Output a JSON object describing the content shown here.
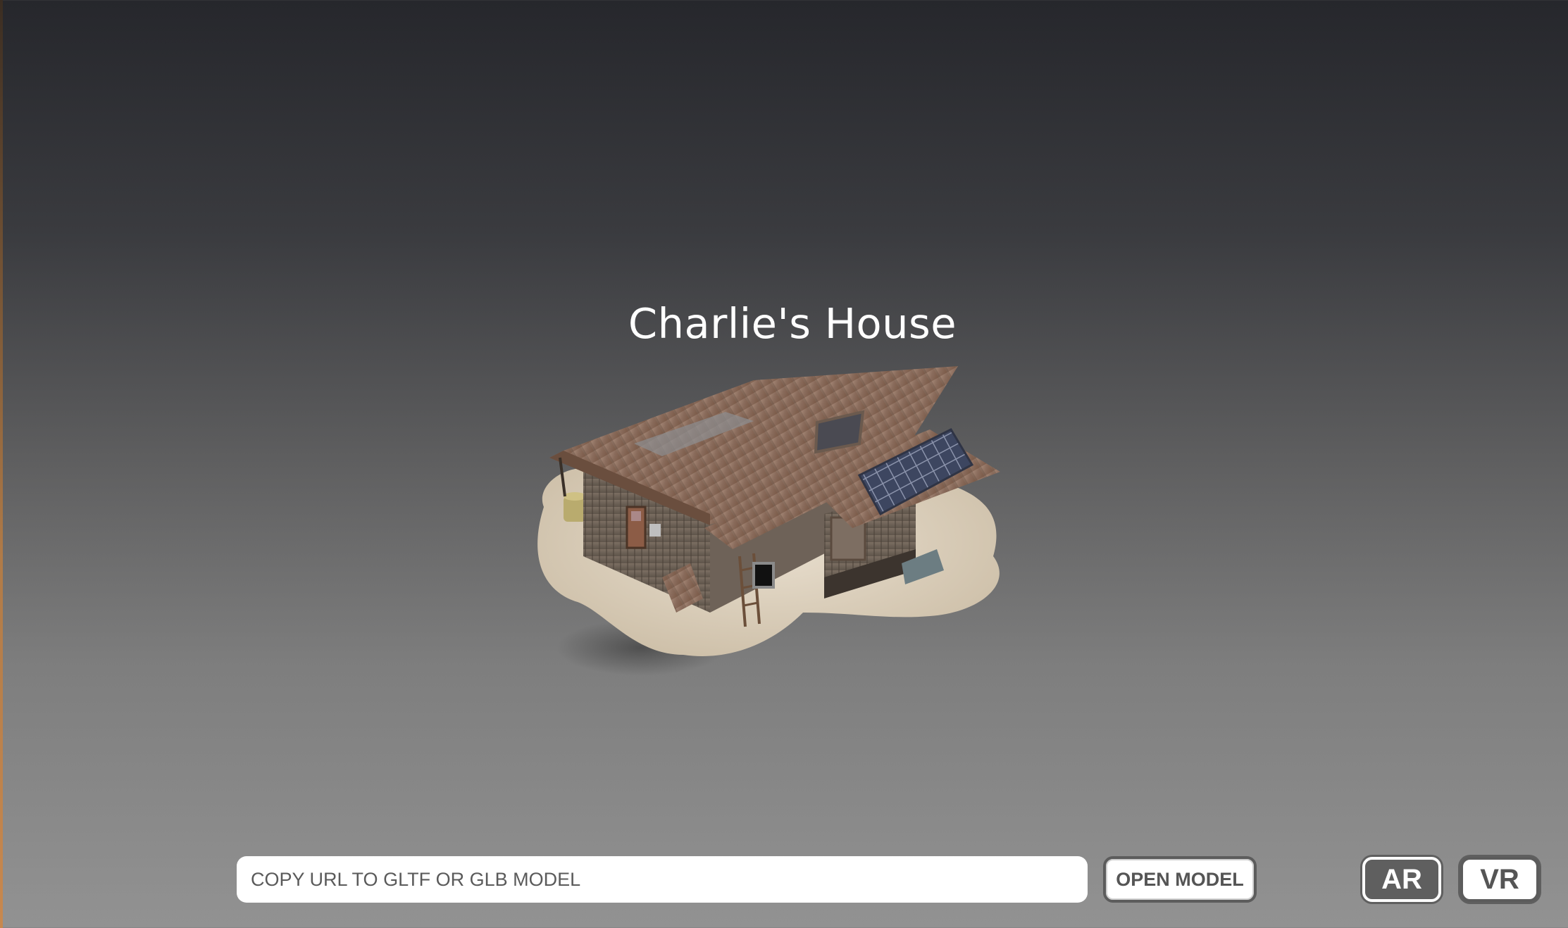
{
  "model": {
    "title": "Charlie's House"
  },
  "toolbar": {
    "url_placeholder": "COPY URL TO GLTF OR GLB MODEL",
    "url_value": "",
    "open_label": "OPEN MODEL",
    "ar_label": "AR",
    "vr_label": "VR"
  },
  "colors": {
    "background_top": "#26272c",
    "background_bottom": "#929292",
    "button_border": "#5c5c5c",
    "text": "#ffffff"
  }
}
